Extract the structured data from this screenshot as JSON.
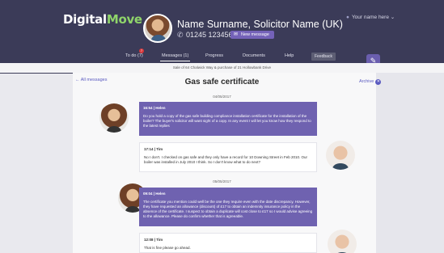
{
  "header": {
    "logo_part1": "Digital",
    "logo_part2": "Move",
    "contact_name": "Name Surname, Solicitor Name (UK)",
    "phone": "01245 123456",
    "new_message_label": "New message",
    "user_label": "Your name here"
  },
  "nav": {
    "items": [
      {
        "label": "To do (7)",
        "badge": "7"
      },
      {
        "label": "Messages (1)"
      },
      {
        "label": "Progress"
      },
      {
        "label": "Documents"
      },
      {
        "label": "Help"
      }
    ],
    "feedback_label": "Feedback"
  },
  "subject": "Sale of 64 Chalwick Way & purchase of 21 Hollowbank Drive",
  "page": {
    "back_label": "All messages",
    "title": "Gas safe certificate",
    "archive_label": "Archive"
  },
  "thread": [
    {
      "date": "04/05/2017"
    },
    {
      "meta": "16:54 | Helen",
      "text": "Do you hold a copy of the gas safe building compliance installation certificate for the installation of the boiler? The buyer's solicitor will want sight of a copy. In any event I will let you know how they respond to the latest replies"
    },
    {
      "meta": "17:14 | Tim",
      "text": "No I don't. I checked on gas safe and they only have a record for 10 Downing Street in Feb 2010. Our boiler was installed in July 2010 I think. So I don't know what to do next?"
    },
    {
      "date": "05/05/2017"
    },
    {
      "meta": "09:04 | Helen",
      "text": "The certificate you mention could well be the one they require even with the date discrepancy. However, they have requested an allowance (discount) of £17 to obtain an indemnity insurance policy in the absence of the certificate. I suspect to obtain a duplicate will cost close to £17 so I would advise agreeing to the allowance. Please do confirm whether that is agreeable."
    },
    {
      "meta": "12:08 | Tim",
      "text": "That is fine please go ahead."
    }
  ]
}
